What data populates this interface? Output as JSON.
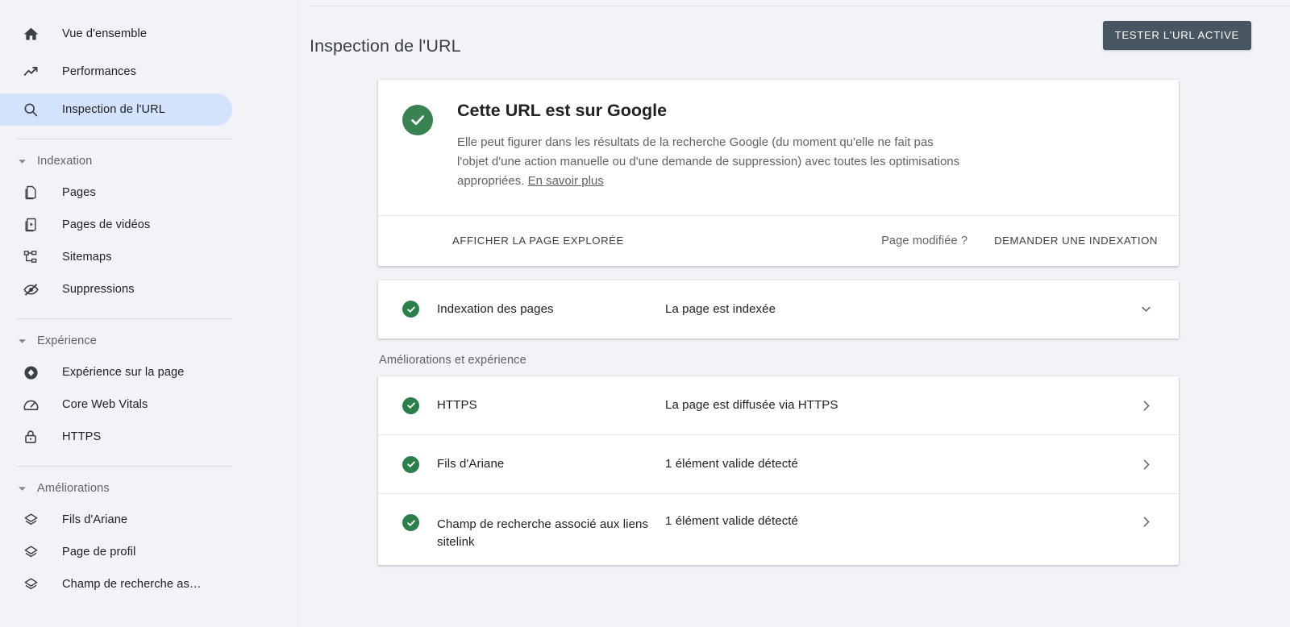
{
  "sidebar": {
    "top_items": [
      {
        "label": "Vue d'ensemble",
        "icon": "home-icon",
        "active": false
      },
      {
        "label": "Performances",
        "icon": "trending-up-icon",
        "active": false
      },
      {
        "label": "Inspection de l'URL",
        "icon": "search-icon",
        "active": true
      }
    ],
    "groups": [
      {
        "label": "Indexation",
        "items": [
          {
            "label": "Pages",
            "icon": "pages-icon"
          },
          {
            "label": "Pages de vidéos",
            "icon": "video-pages-icon"
          },
          {
            "label": "Sitemaps",
            "icon": "sitemap-icon"
          },
          {
            "label": "Suppressions",
            "icon": "eye-off-icon"
          }
        ]
      },
      {
        "label": "Expérience",
        "items": [
          {
            "label": "Expérience sur la page",
            "icon": "page-experience-icon"
          },
          {
            "label": "Core Web Vitals",
            "icon": "speedometer-icon"
          },
          {
            "label": "HTTPS",
            "icon": "lock-icon"
          }
        ]
      },
      {
        "label": "Améliorations",
        "items": [
          {
            "label": "Fils d'Ariane",
            "icon": "layers-icon"
          },
          {
            "label": "Page de profil",
            "icon": "layers-icon"
          },
          {
            "label": "Champ de recherche as…",
            "icon": "layers-icon"
          }
        ]
      }
    ]
  },
  "header": {
    "title": "Inspection de l'URL",
    "test_button": "TESTER L'URL ACTIVE"
  },
  "status_card": {
    "icon": "check-circle-icon",
    "title": "Cette URL est sur Google",
    "description_part1": "Elle peut figurer dans les résultats de la recherche Google (du moment qu'elle ne fait pas l'objet d'une action manuelle ou d'une demande de suppression) avec toutes les optimisations appropriées. ",
    "learn_more": "En savoir plus",
    "actions": {
      "view_crawled_page": "AFFICHER LA PAGE EXPLORÉE",
      "page_modified_question": "Page modifiée ?",
      "request_indexing": "DEMANDER UNE INDEXATION"
    }
  },
  "indexing_card": {
    "rows": [
      {
        "icon": "check-circle-icon",
        "name": "Indexation des pages",
        "value": "La page est indexée",
        "chevron": "chevron-down-icon"
      }
    ]
  },
  "enhancements": {
    "section_label": "Améliorations et expérience",
    "rows": [
      {
        "icon": "check-circle-icon",
        "name": "HTTPS",
        "value": "La page est diffusée via HTTPS",
        "chevron": "chevron-right-icon"
      },
      {
        "icon": "check-circle-icon",
        "name": "Fils d'Ariane",
        "value": "1 élément valide détecté",
        "chevron": "chevron-right-icon"
      },
      {
        "icon": "check-circle-icon",
        "name": "Champ de recherche associé aux liens sitelink",
        "value": "1 élément valide détecté",
        "chevron": "chevron-right-icon"
      }
    ]
  },
  "colors": {
    "page_background": "#f1f3f7",
    "card_background": "#ffffff",
    "active_nav_pill": "#d3e3fd",
    "success_green": "#38834f",
    "success_green_small": "#2a8049",
    "button_dark": "#475661",
    "primary_text": "#202124",
    "secondary_text": "#5f6368"
  }
}
